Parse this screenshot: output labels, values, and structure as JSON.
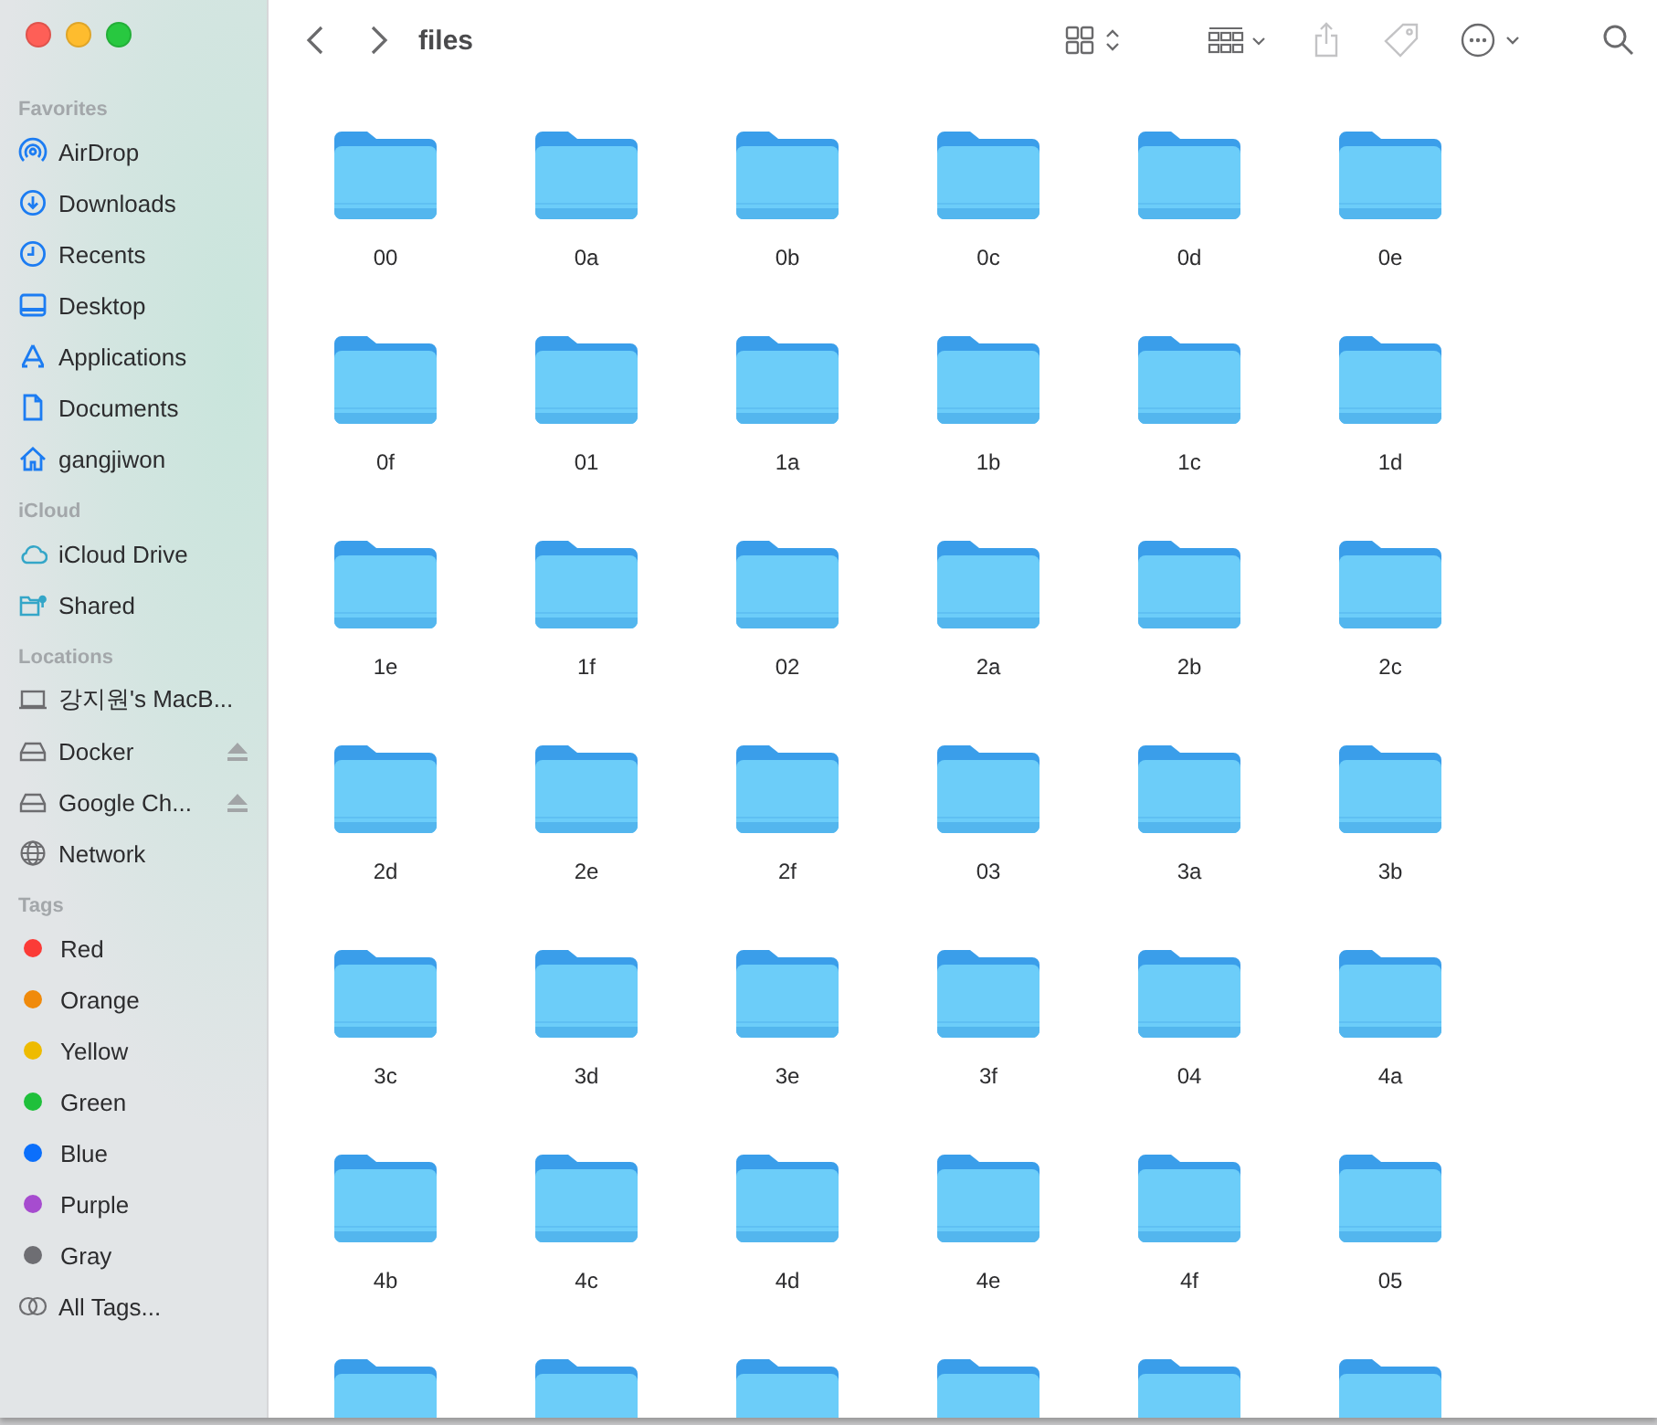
{
  "window": {
    "title": "files"
  },
  "sidebar": {
    "sections": [
      {
        "heading": "Favorites",
        "items": [
          {
            "label": "AirDrop"
          },
          {
            "label": "Downloads"
          },
          {
            "label": "Recents"
          },
          {
            "label": "Desktop"
          },
          {
            "label": "Applications"
          },
          {
            "label": "Documents"
          },
          {
            "label": "gangjiwon"
          }
        ]
      },
      {
        "heading": "iCloud",
        "items": [
          {
            "label": "iCloud Drive"
          },
          {
            "label": "Shared"
          }
        ]
      },
      {
        "heading": "Locations",
        "items": [
          {
            "label": "강지원's MacB...",
            "ejectable": false
          },
          {
            "label": "Docker",
            "ejectable": true
          },
          {
            "label": "Google Ch...",
            "ejectable": true
          },
          {
            "label": "Network",
            "ejectable": false
          }
        ]
      },
      {
        "heading": "Tags",
        "items": [
          {
            "label": "Red",
            "color": "#fb3b37"
          },
          {
            "label": "Orange",
            "color": "#f08a0b"
          },
          {
            "label": "Yellow",
            "color": "#eebb00"
          },
          {
            "label": "Green",
            "color": "#1fc03b"
          },
          {
            "label": "Blue",
            "color": "#0b6ffb"
          },
          {
            "label": "Purple",
            "color": "#a64ccf"
          },
          {
            "label": "Gray",
            "color": "#6e6e73"
          },
          {
            "label": "All Tags..."
          }
        ]
      }
    ]
  },
  "folders": [
    {
      "kind": "folder",
      "name": "00"
    },
    {
      "kind": "folder",
      "name": "0a"
    },
    {
      "kind": "folder",
      "name": "0b"
    },
    {
      "kind": "folder",
      "name": "0c"
    },
    {
      "kind": "folder",
      "name": "0d"
    },
    {
      "kind": "folder",
      "name": "0e"
    },
    {
      "kind": "folder",
      "name": "0f"
    },
    {
      "kind": "folder",
      "name": "01"
    },
    {
      "kind": "folder",
      "name": "1a"
    },
    {
      "kind": "folder",
      "name": "1b"
    },
    {
      "kind": "folder",
      "name": "1c"
    },
    {
      "kind": "folder",
      "name": "1d"
    },
    {
      "kind": "folder",
      "name": "1e"
    },
    {
      "kind": "folder",
      "name": "1f"
    },
    {
      "kind": "folder",
      "name": "02"
    },
    {
      "kind": "folder",
      "name": "2a"
    },
    {
      "kind": "folder",
      "name": "2b"
    },
    {
      "kind": "folder",
      "name": "2c"
    },
    {
      "kind": "folder",
      "name": "2d"
    },
    {
      "kind": "folder",
      "name": "2e"
    },
    {
      "kind": "folder",
      "name": "2f"
    },
    {
      "kind": "folder",
      "name": "03"
    },
    {
      "kind": "folder",
      "name": "3a"
    },
    {
      "kind": "folder",
      "name": "3b"
    },
    {
      "kind": "folder",
      "name": "3c"
    },
    {
      "kind": "folder",
      "name": "3d"
    },
    {
      "kind": "folder",
      "name": "3e"
    },
    {
      "kind": "folder",
      "name": "3f"
    },
    {
      "kind": "folder",
      "name": "04"
    },
    {
      "kind": "folder",
      "name": "4a"
    },
    {
      "kind": "folder",
      "name": "4b"
    },
    {
      "kind": "folder",
      "name": "4c"
    },
    {
      "kind": "folder",
      "name": "4d"
    },
    {
      "kind": "folder",
      "name": "4e"
    },
    {
      "kind": "folder",
      "name": "4f"
    },
    {
      "kind": "folder",
      "name": "05"
    },
    {
      "kind": "cut-off"
    },
    {
      "kind": "cut-off"
    },
    {
      "kind": "cut-off"
    },
    {
      "kind": "cut-off"
    },
    {
      "kind": "cut-off"
    },
    {
      "kind": "cut-off"
    }
  ]
}
